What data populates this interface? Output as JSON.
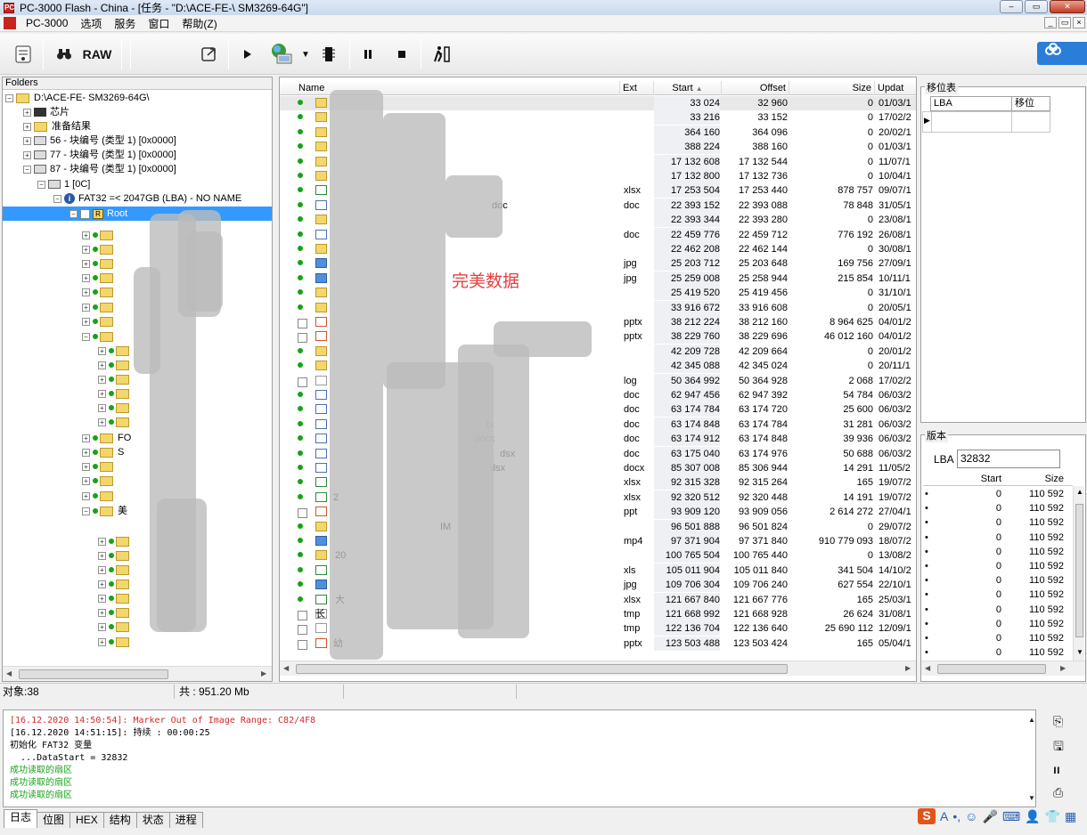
{
  "window": {
    "title": "PC-3000 Flash - China - [任务 - \"D:\\ACE-FE-\\       SM3269-64G\"]",
    "app_abbrev": "PC",
    "controls": [
      "–",
      "▭",
      "✕"
    ]
  },
  "menu": {
    "items": [
      "PC-3000",
      "选项",
      "服务",
      "窗口",
      "帮助(Z)"
    ],
    "mdi_controls": [
      "_",
      "▭",
      "×"
    ]
  },
  "toolbar": {
    "raw_label": "RAW"
  },
  "folders": {
    "header": "Folders",
    "tree": [
      {
        "label": "D:\\ACE-FE-        SM3269-64G\\",
        "icon": "task-icon"
      },
      {
        "label": "芯片",
        "icon": "chip-icon"
      },
      {
        "label": "准备结果",
        "icon": "folder-icon"
      },
      {
        "label": "56 - 块编号 (类型 1) [0x0000]",
        "icon": "disk-icon"
      },
      {
        "label": "77 - 块编号 (类型 1) [0x0000]",
        "icon": "disk-icon"
      },
      {
        "label": "87 - 块编号 (类型 1) [0x0000]",
        "icon": "disk-icon"
      },
      {
        "label": "1 [0C]",
        "icon": "drive-icon"
      },
      {
        "label": "FAT32 =< 2047GB (LBA) - NO NAME",
        "icon": "info-icon"
      },
      {
        "label": "Root",
        "icon": "root-icon"
      }
    ],
    "subfolder_labels": [
      "FO",
      "S",
      "美"
    ]
  },
  "files": {
    "columns": [
      "Name",
      "Ext",
      "Start",
      "Offset",
      "Size",
      "Updat"
    ],
    "watermark": "完美数据",
    "rows": [
      {
        "ext": "",
        "start": "33 024",
        "offset": "32 960",
        "size": "0",
        "date": "01/03/1",
        "icon": "folder"
      },
      {
        "ext": "",
        "start": "33 216",
        "offset": "33 152",
        "size": "0",
        "date": "17/02/2",
        "icon": "folder"
      },
      {
        "ext": "",
        "start": "364 160",
        "offset": "364 096",
        "size": "0",
        "date": "20/02/1",
        "icon": "folder"
      },
      {
        "ext": "",
        "start": "388 224",
        "offset": "388 160",
        "size": "0",
        "date": "01/03/1",
        "icon": "folder"
      },
      {
        "ext": "",
        "start": "17 132 608",
        "offset": "17 132 544",
        "size": "0",
        "date": "11/07/1",
        "icon": "folder"
      },
      {
        "ext": "",
        "start": "17 132 800",
        "offset": "17 132 736",
        "size": "0",
        "date": "10/04/1",
        "icon": "folder"
      },
      {
        "ext": "xlsx",
        "start": "17 253 504",
        "offset": "17 253 440",
        "size": "878 757",
        "date": "09/07/1",
        "icon": "xls"
      },
      {
        "ext": "doc",
        "start": "22 393 152",
        "offset": "22 393 088",
        "size": "78 848",
        "date": "31/05/1",
        "icon": "doc"
      },
      {
        "ext": "",
        "start": "22 393 344",
        "offset": "22 393 280",
        "size": "0",
        "date": "23/08/1",
        "icon": "folder"
      },
      {
        "ext": "doc",
        "start": "22 459 776",
        "offset": "22 459 712",
        "size": "776 192",
        "date": "26/08/1",
        "icon": "doc"
      },
      {
        "ext": "",
        "start": "22 462 208",
        "offset": "22 462 144",
        "size": "0",
        "date": "30/08/1",
        "icon": "folder"
      },
      {
        "ext": "jpg",
        "start": "25 203 712",
        "offset": "25 203 648",
        "size": "169 756",
        "date": "27/09/1",
        "icon": "jpg"
      },
      {
        "ext": "jpg",
        "start": "25 259 008",
        "offset": "25 258 944",
        "size": "215 854",
        "date": "10/11/1",
        "icon": "jpg"
      },
      {
        "ext": "",
        "start": "25 419 520",
        "offset": "25 419 456",
        "size": "0",
        "date": "31/10/1",
        "icon": "folder"
      },
      {
        "ext": "",
        "start": "33 916 672",
        "offset": "33 916 608",
        "size": "0",
        "date": "20/05/1",
        "icon": "folder"
      },
      {
        "ext": "pptx",
        "start": "38 212 224",
        "offset": "38 212 160",
        "size": "8 964 625",
        "date": "04/01/2",
        "icon": "ppt"
      },
      {
        "ext": "pptx",
        "start": "38 229 760",
        "offset": "38 229 696",
        "size": "46 012 160",
        "date": "04/01/2",
        "icon": "ppt"
      },
      {
        "ext": "",
        "start": "42 209 728",
        "offset": "42 209 664",
        "size": "0",
        "date": "20/01/2",
        "icon": "folder"
      },
      {
        "ext": "",
        "start": "42 345 088",
        "offset": "42 345 024",
        "size": "0",
        "date": "20/11/1",
        "icon": "folder"
      },
      {
        "ext": "log",
        "start": "50 364 992",
        "offset": "50 364 928",
        "size": "2 068",
        "date": "17/02/2",
        "icon": "blank"
      },
      {
        "ext": "doc",
        "start": "62 947 456",
        "offset": "62 947 392",
        "size": "54 784",
        "date": "06/03/2",
        "icon": "doc"
      },
      {
        "ext": "doc",
        "start": "63 174 784",
        "offset": "63 174 720",
        "size": "25 600",
        "date": "06/03/2",
        "icon": "doc"
      },
      {
        "ext": "doc",
        "start": "63 174 848",
        "offset": "63 174 784",
        "size": "31 281",
        "date": "06/03/2",
        "icon": "doc"
      },
      {
        "ext": "doc",
        "start": "63 174 912",
        "offset": "63 174 848",
        "size": "39 936",
        "date": "06/03/2",
        "icon": "doc"
      },
      {
        "ext": "doc",
        "start": "63 175 040",
        "offset": "63 174 976",
        "size": "50 688",
        "date": "06/03/2",
        "icon": "doc"
      },
      {
        "ext": "docx",
        "start": "85 307 008",
        "offset": "85 306 944",
        "size": "14 291",
        "date": "11/05/2",
        "icon": "doc"
      },
      {
        "ext": "xlsx",
        "start": "92 315 328",
        "offset": "92 315 264",
        "size": "165",
        "date": "19/07/2",
        "icon": "xls"
      },
      {
        "ext": "xlsx",
        "start": "92 320 512",
        "offset": "92 320 448",
        "size": "14 191",
        "date": "19/07/2",
        "icon": "xls"
      },
      {
        "ext": "ppt",
        "start": "93 909 120",
        "offset": "93 909 056",
        "size": "2 614 272",
        "date": "27/04/1",
        "icon": "ppt"
      },
      {
        "ext": "",
        "start": "96 501 888",
        "offset": "96 501 824",
        "size": "0",
        "date": "29/07/2",
        "icon": "folder"
      },
      {
        "ext": "mp4",
        "start": "97 371 904",
        "offset": "97 371 840",
        "size": "910 779 093",
        "date": "18/07/2",
        "icon": "jpg"
      },
      {
        "ext": "",
        "start": "100 765 504",
        "offset": "100 765 440",
        "size": "0",
        "date": "13/08/2",
        "icon": "folder"
      },
      {
        "ext": "xls",
        "start": "105 011 904",
        "offset": "105 011 840",
        "size": "341 504",
        "date": "14/10/2",
        "icon": "xls"
      },
      {
        "ext": "jpg",
        "start": "109 706 304",
        "offset": "109 706 240",
        "size": "627 554",
        "date": "22/10/1",
        "icon": "jpg"
      },
      {
        "ext": "xlsx",
        "start": "121 667 840",
        "offset": "121 667 776",
        "size": "165",
        "date": "25/03/1",
        "icon": "xls"
      },
      {
        "ext": "tmp",
        "start": "121 668 992",
        "offset": "121 668 928",
        "size": "26 624",
        "date": "31/08/1",
        "icon": "blank"
      },
      {
        "ext": "tmp",
        "start": "122 136 704",
        "offset": "122 136 640",
        "size": "25 690 112",
        "date": "12/09/1",
        "icon": "blank"
      },
      {
        "ext": "pptx",
        "start": "123 503 488",
        "offset": "123 503 424",
        "size": "165",
        "date": "05/04/1",
        "icon": "ppt"
      }
    ],
    "name_fragments": [
      "doc",
      "dsx",
      "docx",
      "dsx",
      "tx",
      "IM",
      "20",
      "大",
      "幼",
      "长",
      "2"
    ]
  },
  "reloc": {
    "title": "移位表",
    "col_lba": "LBA",
    "col_shift": "移位"
  },
  "version": {
    "title": "版本",
    "lba_label": "LBA",
    "lba_value": "32832",
    "col_start": "Start",
    "col_size": "Size",
    "rows": [
      {
        "start": "0",
        "size": "110 592"
      },
      {
        "start": "0",
        "size": "110 592"
      },
      {
        "start": "0",
        "size": "110 592"
      },
      {
        "start": "0",
        "size": "110 592"
      },
      {
        "start": "0",
        "size": "110 592"
      },
      {
        "start": "0",
        "size": "110 592"
      },
      {
        "start": "0",
        "size": "110 592"
      },
      {
        "start": "0",
        "size": "110 592"
      },
      {
        "start": "0",
        "size": "110 592"
      },
      {
        "start": "0",
        "size": "110 592"
      },
      {
        "start": "0",
        "size": "110 592"
      },
      {
        "start": "0",
        "size": "110 592"
      }
    ]
  },
  "status": {
    "objects": "对象:38",
    "total": "共 : 951.20 Mb"
  },
  "log": {
    "lines": [
      {
        "text": "[16.12.2020 14:50:54]: Marker Out of Image Range: C82/4F8",
        "color": "red"
      },
      {
        "text": "[16.12.2020 14:51:15]: 持续 : 00:00:25",
        "color": "black"
      },
      {
        "text": "初始化 FAT32 变量",
        "color": "black"
      },
      {
        "text": "  ...DataStart = 32832",
        "color": "black"
      },
      {
        "text": "成功读取的扇区",
        "color": "green"
      },
      {
        "text": "成功读取的扇区",
        "color": "green"
      },
      {
        "text": "成功读取的扇区",
        "color": "green"
      }
    ]
  },
  "tabs": [
    "日志",
    "位图",
    "HEX",
    "结构",
    "状态",
    "进程"
  ],
  "colors": {
    "selected": "#3399ff",
    "watermark": "#e43f3f",
    "log_red": "#d42a2a",
    "log_green": "#17a31a"
  }
}
